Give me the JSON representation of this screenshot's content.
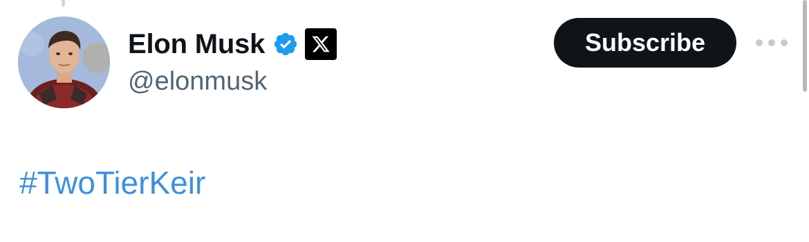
{
  "tweet": {
    "author": {
      "display_name": "Elon Musk",
      "handle": "@elonmusk",
      "verified_icon": "verified-badge-icon",
      "affiliation_icon": "x-logo-icon"
    },
    "actions": {
      "subscribe_label": "Subscribe",
      "more_icon": "ellipsis-icon"
    },
    "text": "#TwoTierKeir"
  },
  "colors": {
    "name": "#0f1419",
    "handle": "#536471",
    "hashtag": "#3f8fdc",
    "verified": "#1d9bf0",
    "button_bg": "#0f1419",
    "button_text": "#ffffff"
  }
}
